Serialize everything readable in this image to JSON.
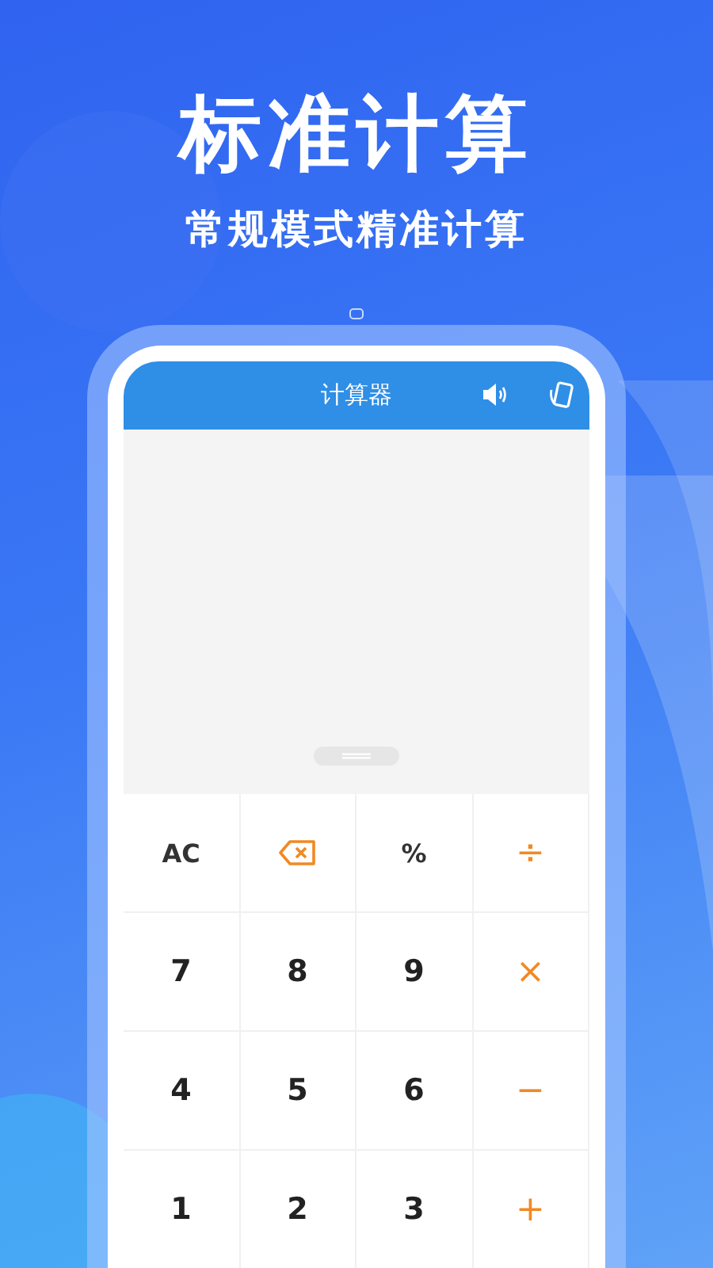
{
  "headline": "标准计算",
  "subtitle": "常规模式精准计算",
  "app_bar": {
    "title": "计算器"
  },
  "keypad": [
    [
      {
        "kind": "clear",
        "label": "AC"
      },
      {
        "kind": "backspace"
      },
      {
        "kind": "function",
        "label": "%"
      },
      {
        "kind": "operator",
        "label": "÷"
      }
    ],
    [
      {
        "kind": "digit",
        "label": "7"
      },
      {
        "kind": "digit",
        "label": "8"
      },
      {
        "kind": "digit",
        "label": "9"
      },
      {
        "kind": "operator",
        "label": "×"
      }
    ],
    [
      {
        "kind": "digit",
        "label": "4"
      },
      {
        "kind": "digit",
        "label": "5"
      },
      {
        "kind": "digit",
        "label": "6"
      },
      {
        "kind": "operator",
        "label": "−"
      }
    ],
    [
      {
        "kind": "digit",
        "label": "1"
      },
      {
        "kind": "digit",
        "label": "2"
      },
      {
        "kind": "digit",
        "label": "3"
      },
      {
        "kind": "operator",
        "label": "+"
      }
    ]
  ]
}
